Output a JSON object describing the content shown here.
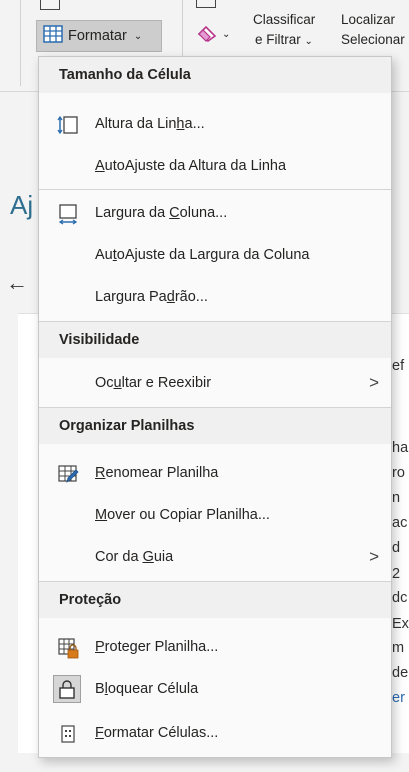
{
  "ribbon": {
    "format_label": "Formatar",
    "sort_line1": "Classificar",
    "sort_line2": "e Filtrar",
    "find_line1": "Localizar",
    "find_line2": "Selecionar",
    "icons": [
      "format-cells-icon",
      "eraser-icon",
      "sort-filter-icon"
    ]
  },
  "background": {
    "heading_fragment": "Aj",
    "back_arrow": "←",
    "fragment_ref": "ef",
    "right_lines": [
      "ha",
      "ro",
      "n",
      "ac",
      "d",
      "2",
      "dc",
      "Ex",
      "m",
      "de",
      "er"
    ]
  },
  "menu": {
    "sections": {
      "cell_size": "Tamanho da Célula",
      "visibility": "Visibilidade",
      "organize": "Organizar Planilhas",
      "protection": "Proteção"
    },
    "items": {
      "row_height": {
        "pre": "Altura da Lin",
        "key": "h",
        "post": "a..."
      },
      "autofit_row": {
        "pre": "",
        "key": "A",
        "post": "utoAjuste da Altura da Linha"
      },
      "col_width": {
        "pre": "Largura da ",
        "key": "C",
        "post": "oluna..."
      },
      "autofit_col": {
        "pre": "Au",
        "key": "t",
        "post": "oAjuste da Largura da Coluna"
      },
      "default_width": {
        "pre": "Largura Pa",
        "key": "d",
        "post": "rão..."
      },
      "hide_unhide": {
        "pre": "Oc",
        "key": "u",
        "post": "ltar e Reexibir"
      },
      "rename_sheet": {
        "pre": "",
        "key": "R",
        "post": "enomear Planilha"
      },
      "move_copy": {
        "pre": "",
        "key": "M",
        "post": "over ou Copiar Planilha..."
      },
      "tab_color": {
        "pre": "Cor da ",
        "key": "G",
        "post": "uia"
      },
      "protect_sheet": {
        "pre": "",
        "key": "P",
        "post": "roteger Planilha..."
      },
      "lock_cell": {
        "pre": "B",
        "key": "l",
        "post": "oquear Célula"
      },
      "format_cells": {
        "pre": "",
        "key": "F",
        "post": "ormatar Células..."
      }
    },
    "submenu_arrow": ">"
  },
  "colors": {
    "accent_blue": "#2b6cb0",
    "lock_orange": "#d77a1c",
    "menu_bg": "#fafafa",
    "header_bg": "#f0f0f0"
  }
}
